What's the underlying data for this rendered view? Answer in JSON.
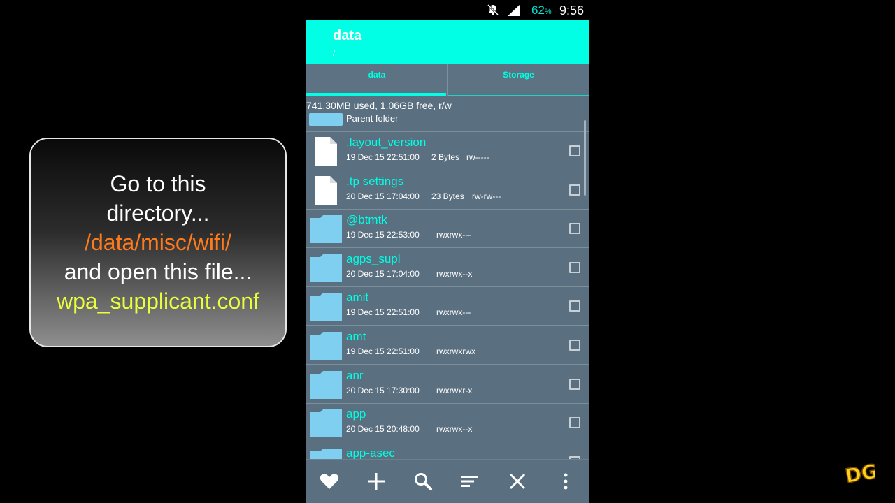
{
  "overlay": {
    "line1": "Go to this",
    "line2": "directory...",
    "path": "/data/misc/wifi/",
    "line4": "and open this file...",
    "filename": "wpa_supplicant.conf"
  },
  "status_bar": {
    "battery_percent": "62",
    "battery_unit": "%",
    "time": "9:56"
  },
  "app_bar": {
    "title": "data",
    "subtitle": "/"
  },
  "tabs": [
    {
      "label": "data",
      "selected": true
    },
    {
      "label": "Storage",
      "selected": false
    }
  ],
  "storage_info": "741.30MB used, 1.06GB free, r/w",
  "parent_folder": "Parent folder",
  "files": [
    {
      "name": ".layout_version",
      "date": "19 Dec 15 22:51:00",
      "size": "2 Bytes",
      "perm": "rw-----",
      "type": "file"
    },
    {
      "name": ".tp settings",
      "date": "20 Dec 15 17:04:00",
      "size": "23 Bytes",
      "perm": "rw-rw---",
      "type": "file"
    },
    {
      "name": "@btmtk",
      "date": "19 Dec 15 22:53:00",
      "size": "",
      "perm": "rwxrwx---",
      "type": "folder"
    },
    {
      "name": "agps_supl",
      "date": "20 Dec 15 17:04:00",
      "size": "",
      "perm": "rwxrwx--x",
      "type": "folder"
    },
    {
      "name": "amit",
      "date": "19 Dec 15 22:51:00",
      "size": "",
      "perm": "rwxrwx---",
      "type": "folder"
    },
    {
      "name": "amt",
      "date": "19 Dec 15 22:51:00",
      "size": "",
      "perm": "rwxrwxrwx",
      "type": "folder"
    },
    {
      "name": "anr",
      "date": "20 Dec 15 17:30:00",
      "size": "",
      "perm": "rwxrwxr-x",
      "type": "folder"
    },
    {
      "name": "app",
      "date": "20 Dec 15 20:48:00",
      "size": "",
      "perm": "rwxrwx--x",
      "type": "folder"
    },
    {
      "name": "app-asec",
      "date": "",
      "size": "",
      "perm": "",
      "type": "folder"
    }
  ],
  "bottom_bar": [
    "heart-icon",
    "plus-icon",
    "search-icon",
    "sort-icon",
    "close-icon",
    "more-vert-icon"
  ],
  "watermark": "DG",
  "colors": {
    "accent": "#00ffe4",
    "background": "#5a6f80",
    "folder": "#7fd0f0",
    "overlay_path": "#ff7a1a",
    "overlay_file": "#eaff3c"
  }
}
